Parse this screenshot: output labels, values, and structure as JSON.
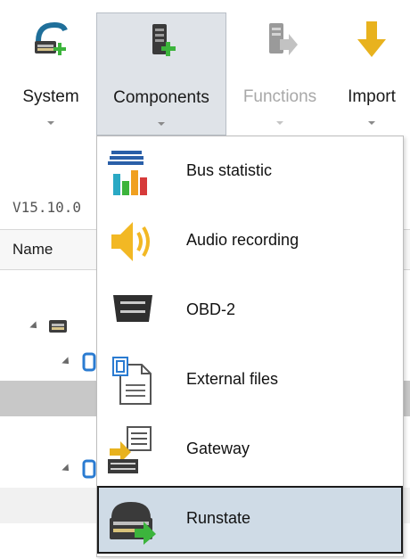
{
  "ribbon": {
    "buttons": [
      {
        "label": "System",
        "icon": "system-add-icon"
      },
      {
        "label": "Components",
        "icon": "component-add-icon"
      },
      {
        "label": "Functions",
        "icon": "function-arrow-icon"
      },
      {
        "label": "Import",
        "icon": "import-arrow-icon"
      }
    ]
  },
  "panel": {
    "version": "V15.10.0",
    "column_name": "Name"
  },
  "menu": {
    "items": [
      {
        "label": "Bus statistic",
        "icon": "bus-statistic-icon"
      },
      {
        "label": "Audio recording",
        "icon": "speaker-icon"
      },
      {
        "label": "OBD-2",
        "icon": "obd-connector-icon"
      },
      {
        "label": "External files",
        "icon": "external-file-icon"
      },
      {
        "label": "Gateway",
        "icon": "gateway-icon"
      },
      {
        "label": "Runstate",
        "icon": "runstate-icon"
      }
    ]
  },
  "colors": {
    "accent_green": "#3cb43c",
    "import_yellow": "#e8b21e",
    "hover_background": "#cfdbe6"
  }
}
